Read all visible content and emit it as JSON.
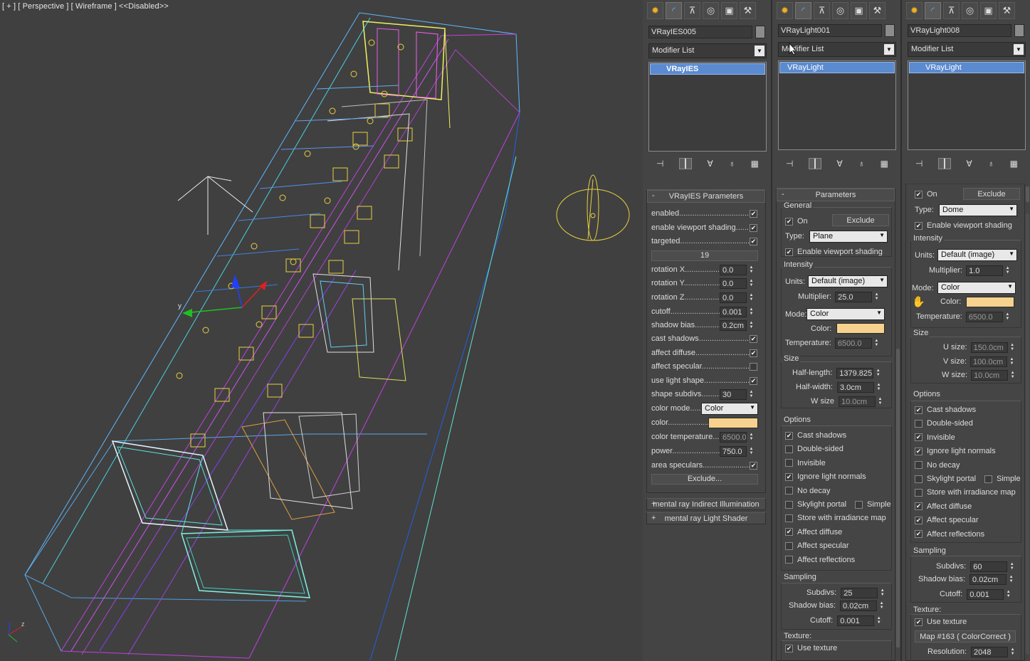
{
  "viewport": {
    "label": "[ + ] [ Perspective ] [ Wireframe ] <<Disabled>>",
    "gizmo": {
      "x_label": "x",
      "y_label": "y",
      "z_label": "z"
    }
  },
  "icons": [
    "create-icon",
    "modify-icon",
    "hierarchy-icon",
    "motion-icon",
    "display-icon",
    "utilities-icon"
  ],
  "panel1": {
    "object_name": "VRayIES005",
    "modifier_list": "Modifier List",
    "stack_item": "VRayIES",
    "rollout_title": "VRayIES Parameters",
    "params": [
      {
        "label": "enabled",
        "type": "check",
        "checked": true
      },
      {
        "label": "enable viewport shading",
        "type": "check",
        "checked": true
      },
      {
        "label": "targeted",
        "type": "check",
        "checked": true
      },
      {
        "label": "19",
        "type": "button"
      },
      {
        "label": "rotation X",
        "type": "spin",
        "value": "0.0"
      },
      {
        "label": "rotation Y",
        "type": "spin",
        "value": "0.0"
      },
      {
        "label": "rotation Z",
        "type": "spin",
        "value": "0.0"
      },
      {
        "label": "cutoff",
        "type": "spin",
        "value": "0.001"
      },
      {
        "label": "shadow bias",
        "type": "spin",
        "value": "0.2cm"
      },
      {
        "label": "cast shadows",
        "type": "check",
        "checked": true
      },
      {
        "label": "affect diffuse",
        "type": "check",
        "checked": true
      },
      {
        "label": "affect specular",
        "type": "check",
        "checked": false
      },
      {
        "label": "use light shape",
        "type": "check",
        "checked": true
      },
      {
        "label": "shape subdivs",
        "type": "spin",
        "value": "30"
      },
      {
        "label": "color mode",
        "type": "dropdown",
        "value": "Color"
      },
      {
        "label": "color",
        "type": "swatch"
      },
      {
        "label": "color temperature",
        "type": "spin",
        "value": "6500.0",
        "dim": true
      },
      {
        "label": "power",
        "type": "spin",
        "value": "750.0"
      },
      {
        "label": "area speculars",
        "type": "check",
        "checked": true
      },
      {
        "label": "Exclude...",
        "type": "button"
      }
    ],
    "collapsed_rollouts": [
      "mental ray Indirect Illumination",
      "mental ray Light Shader"
    ]
  },
  "panel2": {
    "object_name": "VRayLight001",
    "modifier_list": "Modifier List",
    "stack_item": "VRayLight",
    "rollout_title": "Parameters",
    "general_label": "General",
    "on_label": "On",
    "exclude_label": "Exclude",
    "type_label": "Type:",
    "type_value": "Plane",
    "enable_viewport_shading": "Enable viewport shading",
    "intensity_label": "Intensity",
    "units_label": "Units:",
    "units_value": "Default (image)",
    "multiplier_label": "Multiplier:",
    "multiplier_value": "25.0",
    "mode_label": "Mode:",
    "mode_value": "Color",
    "color_label": "Color:",
    "temperature_label": "Temperature:",
    "temperature_value": "6500.0",
    "size_label": "Size",
    "half_length_label": "Half-length:",
    "half_length_value": "1379.825",
    "half_width_label": "Half-width:",
    "half_width_value": "3.0cm",
    "w_size_label": "W size",
    "w_size_value": "10.0cm",
    "options_label": "Options",
    "options": [
      {
        "label": "Cast shadows",
        "checked": true
      },
      {
        "label": "Double-sided",
        "checked": false
      },
      {
        "label": "Invisible",
        "checked": false
      },
      {
        "label": "Ignore light normals",
        "checked": true
      },
      {
        "label": "No decay",
        "checked": false
      },
      {
        "label": "Skylight portal",
        "checked": false
      },
      {
        "label": "Store with irradiance map",
        "checked": false
      },
      {
        "label": "Affect diffuse",
        "checked": true
      },
      {
        "label": "Affect specular",
        "checked": false
      },
      {
        "label": "Affect reflections",
        "checked": false
      }
    ],
    "simple_label": "Simple",
    "sampling_label": "Sampling",
    "subdivs_label": "Subdivs:",
    "subdivs_value": "25",
    "shadow_bias_label": "Shadow bias:",
    "shadow_bias_value": "0.02cm",
    "cutoff_label": "Cutoff:",
    "cutoff_value": "0.001",
    "texture_label": "Texture:",
    "use_texture_label": "Use texture"
  },
  "panel3": {
    "object_name": "VRayLight008",
    "modifier_list": "Modifier List",
    "stack_item": "VRayLight",
    "on_label": "On",
    "exclude_label": "Exclude",
    "type_label": "Type:",
    "type_value": "Dome",
    "enable_viewport_shading": "Enable viewport shading",
    "intensity_label": "Intensity",
    "units_label": "Units:",
    "units_value": "Default (image)",
    "multiplier_label": "Multiplier:",
    "multiplier_value": "1.0",
    "mode_label": "Mode:",
    "mode_value": "Color",
    "color_label": "Color:",
    "temperature_label": "Temperature:",
    "temperature_value": "6500.0",
    "size_label": "Size",
    "u_size_label": "U size:",
    "u_size_value": "150.0cm",
    "v_size_label": "V size:",
    "v_size_value": "100.0cm",
    "w_size_label": "W size:",
    "w_size_value": "10.0cm",
    "options_label": "Options",
    "options": [
      {
        "label": "Cast shadows",
        "checked": true
      },
      {
        "label": "Double-sided",
        "checked": false
      },
      {
        "label": "Invisible",
        "checked": true
      },
      {
        "label": "Ignore light normals",
        "checked": true
      },
      {
        "label": "No decay",
        "checked": false
      },
      {
        "label": "Skylight portal",
        "checked": false
      },
      {
        "label": "Store with irradiance map",
        "checked": false
      },
      {
        "label": "Affect diffuse",
        "checked": true
      },
      {
        "label": "Affect specular",
        "checked": true
      },
      {
        "label": "Affect reflections",
        "checked": true
      }
    ],
    "simple_label": "Simple",
    "sampling_label": "Sampling",
    "subdivs_label": "Subdivs:",
    "subdivs_value": "60",
    "shadow_bias_label": "Shadow bias:",
    "shadow_bias_value": "0.02cm",
    "cutoff_label": "Cutoff:",
    "cutoff_value": "0.001",
    "texture_label": "Texture:",
    "use_texture_label": "Use texture",
    "map_button": "Map #163  ( ColorCorrect )",
    "resolution_label": "Resolution:",
    "resolution_value": "2048"
  },
  "colors": {
    "light_color": "#f7d28e",
    "selection": "#5a8ad0",
    "viewport_bg": "#404040"
  }
}
